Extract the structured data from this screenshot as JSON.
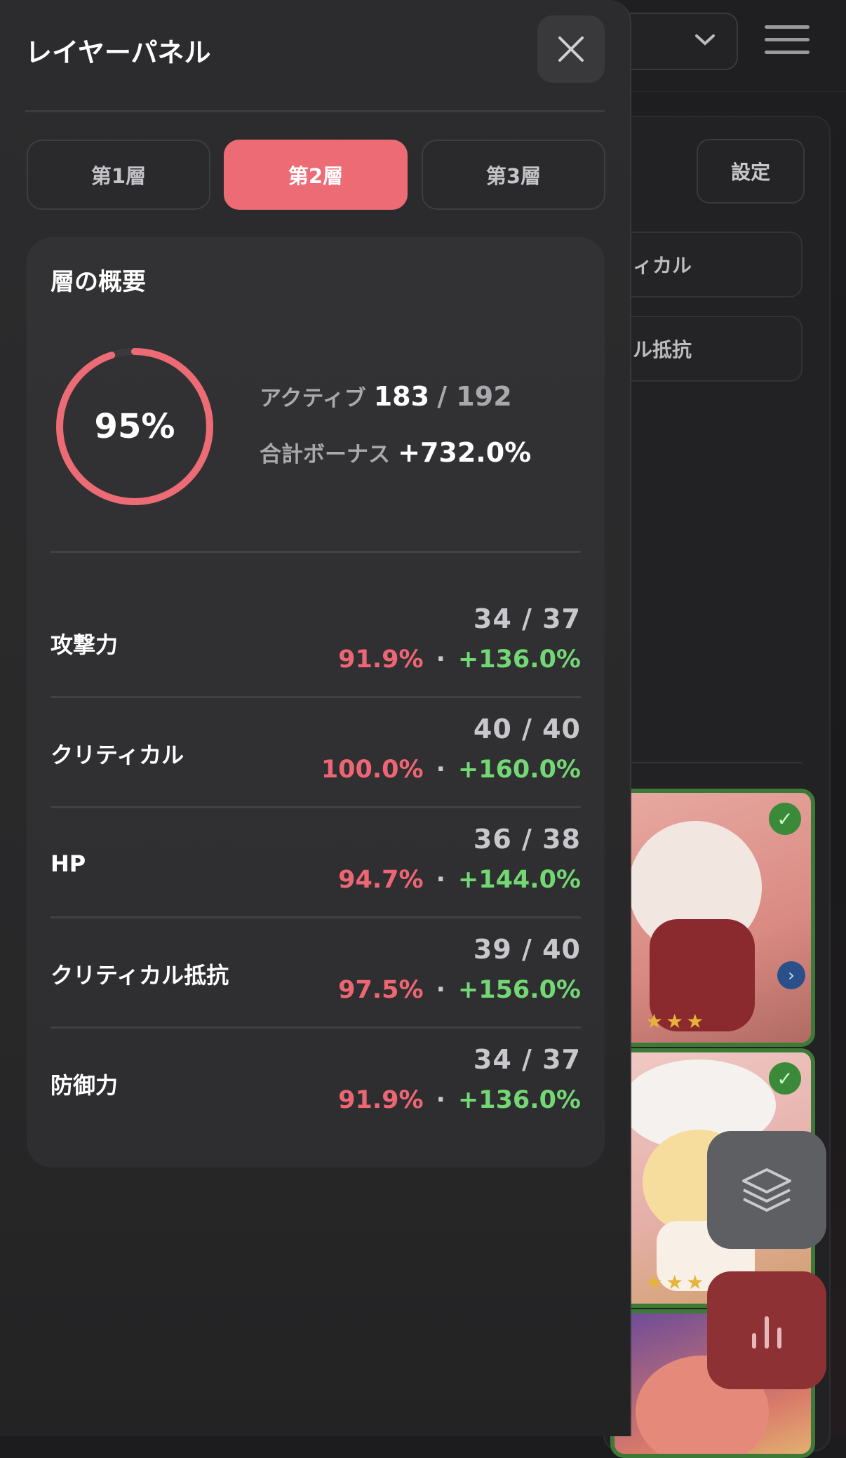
{
  "background": {
    "settings_label": "設定",
    "filters": [
      "ィカル",
      "ル抵抗"
    ]
  },
  "drawer": {
    "title": "レイヤーパネル",
    "tabs": [
      {
        "label": "第1層",
        "active": false
      },
      {
        "label": "第2層",
        "active": true
      },
      {
        "label": "第3層",
        "active": false
      }
    ],
    "overview": {
      "title": "層の概要",
      "percent_label": "95%",
      "percent": 95,
      "active_label": "アクティブ",
      "active_count": "183",
      "active_total": "/ 192",
      "bonus_label": "合計ボーナス",
      "bonus_value": "+732.0%"
    },
    "stats": [
      {
        "name": "攻撃力",
        "count": "34 / 37",
        "pct": "91.9%",
        "bonus": "+136.0%"
      },
      {
        "name": "クリティカル",
        "count": "40 / 40",
        "pct": "100.0%",
        "bonus": "+160.0%"
      },
      {
        "name": "HP",
        "count": "36 / 38",
        "pct": "94.7%",
        "bonus": "+144.0%"
      },
      {
        "name": "クリティカル抵抗",
        "count": "39 / 40",
        "pct": "97.5%",
        "bonus": "+156.0%"
      },
      {
        "name": "防御力",
        "count": "34 / 37",
        "pct": "91.9%",
        "bonus": "+136.0%"
      }
    ],
    "separator": "·"
  },
  "colors": {
    "accent": "#ec6b75",
    "positive": "#72d774",
    "ring_track": "#3a3a3c"
  }
}
